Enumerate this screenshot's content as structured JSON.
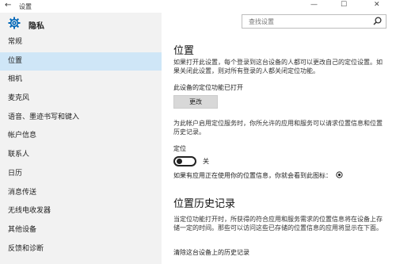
{
  "titlebar": {
    "back_glyph": "←",
    "title": "设置",
    "minimize": "—",
    "maximize": "☐",
    "close": "✕"
  },
  "sidebar": {
    "header": "隐私",
    "items": [
      {
        "label": "常规"
      },
      {
        "label": "位置"
      },
      {
        "label": "相机"
      },
      {
        "label": "麦克风"
      },
      {
        "label": "语音、墨迹书写和键入"
      },
      {
        "label": "帐户信息"
      },
      {
        "label": "联系人"
      },
      {
        "label": "日历"
      },
      {
        "label": "消息传送"
      },
      {
        "label": "无线电收发器"
      },
      {
        "label": "其他设备"
      },
      {
        "label": "反馈和诊断"
      }
    ],
    "active_index": 1
  },
  "search": {
    "placeholder": "查找设置"
  },
  "main": {
    "title": "位置",
    "intro": "如果打开此设置，每个登录到这台设备的人都可以更改自己的定位设置。如果关闭此设置，则对所有登录的人都关闭定位功能。",
    "device_status": "此设备的定位功能已打开",
    "change_button": "更改",
    "account_desc": "为此帐户启用定位服务时，你所允许的应用和服务可以请求位置信息和位置历史记录。",
    "location_label": "定位",
    "toggle_state": "关",
    "toggle_on": false,
    "in_use_note": "如果有应用正在使用你的位置信息，你就会看到此图标：",
    "history_title": "位置历史记录",
    "history_desc": "当定位功能打开时，所获得的符合应用和服务需求的位置信息将在设备上存储一定的时间。那些可以访问这些已存储的位置信息的应用将显示在下面。",
    "clear_label": "清除这台设备上的历史记录"
  },
  "colors": {
    "sidebar_bg": "#f2f2f2",
    "active_item": "#cfe6f7",
    "button_bg": "#d8d8d8"
  }
}
